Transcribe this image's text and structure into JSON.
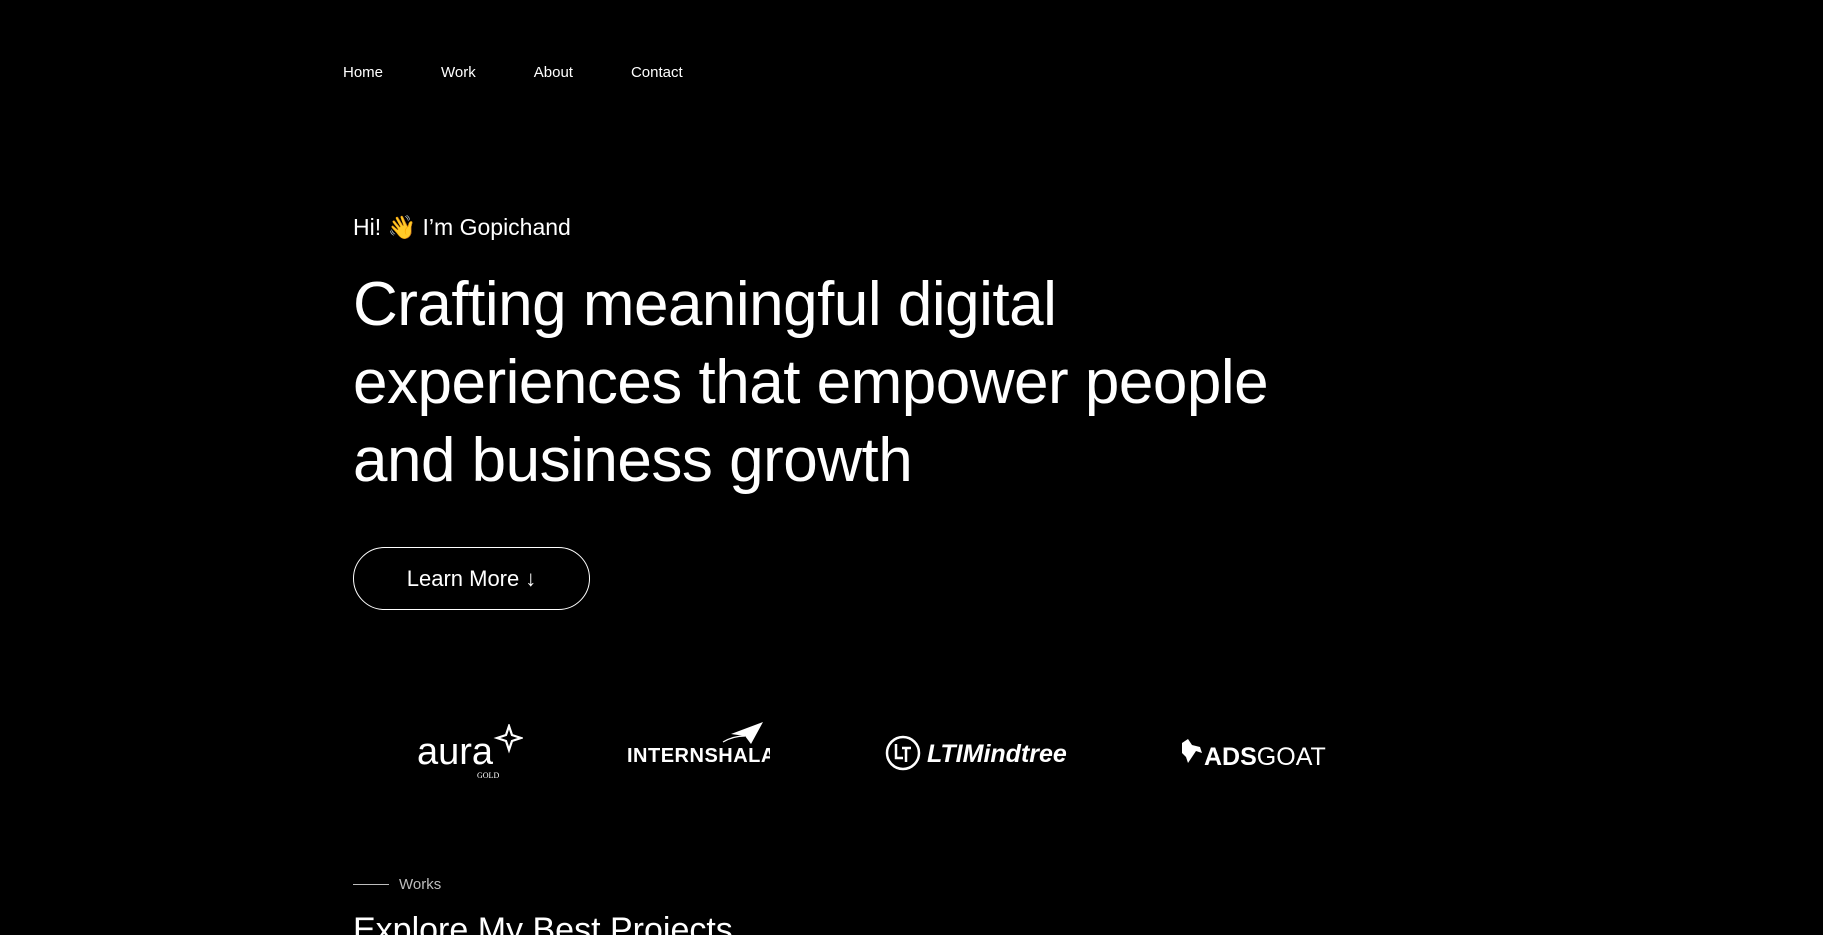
{
  "nav": {
    "items": [
      {
        "label": "Home"
      },
      {
        "label": "Work"
      },
      {
        "label": "About"
      },
      {
        "label": "Contact"
      }
    ]
  },
  "hero": {
    "greeting_prefix": "Hi!",
    "wave_emoji": "👋",
    "greeting_name": "I’m Gopichand",
    "headline_lines": [
      "Crafting meaningful digital",
      "experiences that empower people",
      "and business growth"
    ],
    "cta_label": "Learn More",
    "cta_icon": "arrow-down-icon",
    "cta_arrow": "↓"
  },
  "clients": {
    "logos": [
      {
        "name": "aura-gold",
        "word": "aura",
        "sub": "GOLD"
      },
      {
        "name": "internshala",
        "word": "INTERNSHALA"
      },
      {
        "name": "ltimindtree",
        "word": "LTIMindtree"
      },
      {
        "name": "adsgoat",
        "word_bold": "ADS",
        "word_light": "GOAT"
      }
    ]
  },
  "works": {
    "label": "Works",
    "title": "Explore My Best Projects"
  },
  "colors": {
    "background": "#000000",
    "text": "#ffffff",
    "muted": "#bdbdbd",
    "accent_wave": "#f5c33b"
  }
}
